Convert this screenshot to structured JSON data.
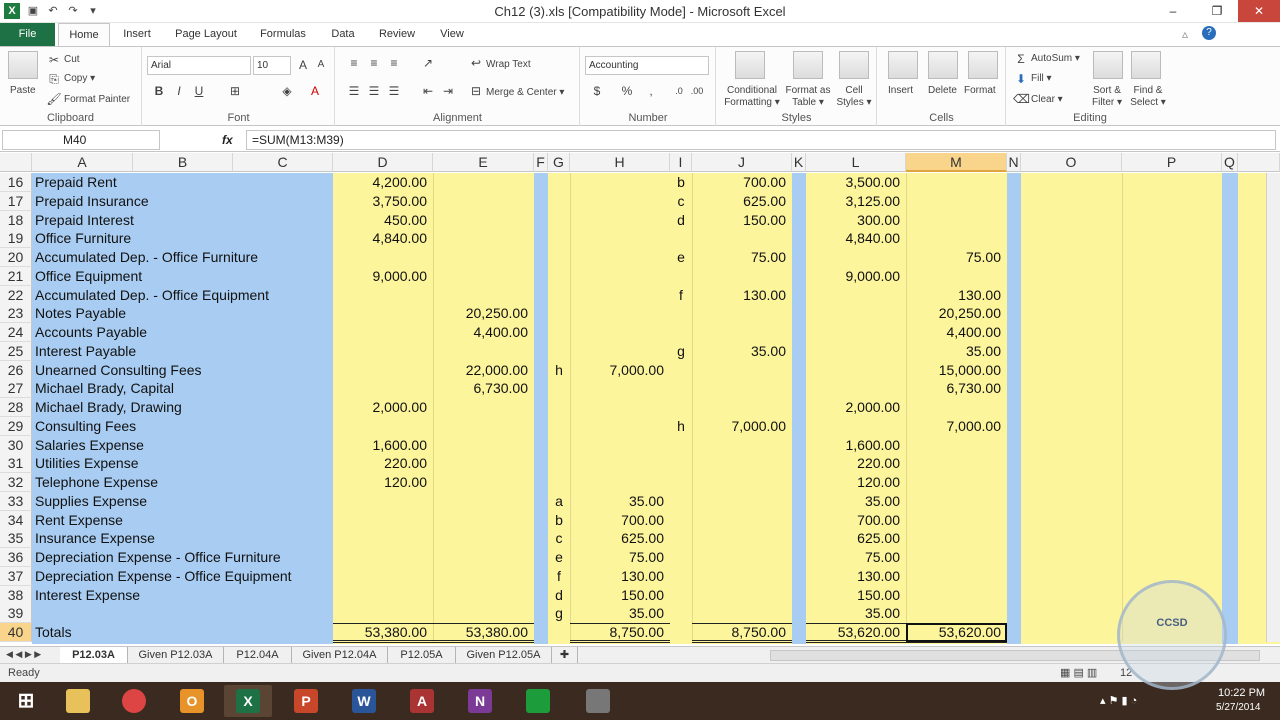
{
  "titlebar": {
    "title": "Ch12 (3).xls  [Compatibility Mode]  -  Microsoft Excel",
    "min": "–",
    "max": "❐",
    "close": "✕"
  },
  "tabs": {
    "file": "File",
    "items": [
      "Home",
      "Insert",
      "Page Layout",
      "Formulas",
      "Data",
      "Review",
      "View"
    ]
  },
  "ribbon": {
    "clipboard": {
      "label": "Clipboard",
      "paste": "Paste",
      "cut": "Cut",
      "copy": "Copy ▾",
      "format_painter": "Format Painter"
    },
    "font": {
      "label": "Font",
      "name": "Arial",
      "size": "10"
    },
    "alignment": {
      "label": "Alignment",
      "wrap": "Wrap Text",
      "merge": "Merge & Center ▾"
    },
    "number": {
      "label": "Number",
      "format": "Accounting"
    },
    "styles": {
      "label": "Styles",
      "conditional": "Conditional Formatting ▾",
      "format_table": "Format as Table ▾",
      "cell_styles": "Cell Styles ▾"
    },
    "cells": {
      "label": "Cells",
      "insert": "Insert",
      "delete": "Delete",
      "format": "Format"
    },
    "editing": {
      "label": "Editing",
      "autosum": "AutoSum ▾",
      "fill": "Fill ▾",
      "clear": "Clear ▾",
      "sort": "Sort & Filter ▾",
      "find": "Find & Select ▾"
    }
  },
  "formula_bar": {
    "name_box": "M40",
    "fx": "fx",
    "formula": "=SUM(M13:M39)"
  },
  "columns": [
    "A",
    "B",
    "C",
    "D",
    "E",
    "F",
    "G",
    "H",
    "I",
    "J",
    "K",
    "L",
    "M",
    "N",
    "O",
    "P",
    "Q"
  ],
  "rows": [
    {
      "n": "16",
      "a": "Prepaid Rent",
      "d": "4,200.00",
      "e": "",
      "g": "",
      "h": "",
      "i": "b",
      "j": "700.00",
      "l": "3,500.00",
      "m": ""
    },
    {
      "n": "17",
      "a": "Prepaid Insurance",
      "d": "3,750.00",
      "e": "",
      "g": "",
      "h": "",
      "i": "c",
      "j": "625.00",
      "l": "3,125.00",
      "m": ""
    },
    {
      "n": "18",
      "a": "Prepaid Interest",
      "d": "450.00",
      "e": "",
      "g": "",
      "h": "",
      "i": "d",
      "j": "150.00",
      "l": "300.00",
      "m": ""
    },
    {
      "n": "19",
      "a": "Office Furniture",
      "d": "4,840.00",
      "e": "",
      "g": "",
      "h": "",
      "i": "",
      "j": "",
      "l": "4,840.00",
      "m": ""
    },
    {
      "n": "20",
      "a": "Accumulated Dep. - Office Furniture",
      "d": "",
      "e": "",
      "g": "",
      "h": "",
      "i": "e",
      "j": "75.00",
      "l": "",
      "m": "75.00"
    },
    {
      "n": "21",
      "a": "Office Equipment",
      "d": "9,000.00",
      "e": "",
      "g": "",
      "h": "",
      "i": "",
      "j": "",
      "l": "9,000.00",
      "m": ""
    },
    {
      "n": "22",
      "a": "Accumulated Dep. - Office Equipment",
      "d": "",
      "e": "",
      "g": "",
      "h": "",
      "i": "f",
      "j": "130.00",
      "l": "",
      "m": "130.00"
    },
    {
      "n": "23",
      "a": "Notes Payable",
      "d": "",
      "e": "20,250.00",
      "g": "",
      "h": "",
      "i": "",
      "j": "",
      "l": "",
      "m": "20,250.00"
    },
    {
      "n": "24",
      "a": "Accounts Payable",
      "d": "",
      "e": "4,400.00",
      "g": "",
      "h": "",
      "i": "",
      "j": "",
      "l": "",
      "m": "4,400.00"
    },
    {
      "n": "25",
      "a": "Interest Payable",
      "d": "",
      "e": "",
      "g": "",
      "h": "",
      "i": "g",
      "j": "35.00",
      "l": "",
      "m": "35.00"
    },
    {
      "n": "26",
      "a": "Unearned Consulting Fees",
      "d": "",
      "e": "22,000.00",
      "g": "h",
      "h": "7,000.00",
      "i": "",
      "j": "",
      "l": "",
      "m": "15,000.00"
    },
    {
      "n": "27",
      "a": "Michael Brady, Capital",
      "d": "",
      "e": "6,730.00",
      "g": "",
      "h": "",
      "i": "",
      "j": "",
      "l": "",
      "m": "6,730.00"
    },
    {
      "n": "28",
      "a": "Michael Brady, Drawing",
      "d": "2,000.00",
      "e": "",
      "g": "",
      "h": "",
      "i": "",
      "j": "",
      "l": "2,000.00",
      "m": ""
    },
    {
      "n": "29",
      "a": "Consulting Fees",
      "d": "",
      "e": "",
      "g": "",
      "h": "",
      "i": "h",
      "j": "7,000.00",
      "l": "",
      "m": "7,000.00"
    },
    {
      "n": "30",
      "a": "Salaries Expense",
      "d": "1,600.00",
      "e": "",
      "g": "",
      "h": "",
      "i": "",
      "j": "",
      "l": "1,600.00",
      "m": ""
    },
    {
      "n": "31",
      "a": "Utilities Expense",
      "d": "220.00",
      "e": "",
      "g": "",
      "h": "",
      "i": "",
      "j": "",
      "l": "220.00",
      "m": ""
    },
    {
      "n": "32",
      "a": "Telephone Expense",
      "d": "120.00",
      "e": "",
      "g": "",
      "h": "",
      "i": "",
      "j": "",
      "l": "120.00",
      "m": ""
    },
    {
      "n": "33",
      "a": "Supplies Expense",
      "d": "",
      "e": "",
      "g": "a",
      "h": "35.00",
      "i": "",
      "j": "",
      "l": "35.00",
      "m": ""
    },
    {
      "n": "34",
      "a": "Rent Expense",
      "d": "",
      "e": "",
      "g": "b",
      "h": "700.00",
      "i": "",
      "j": "",
      "l": "700.00",
      "m": ""
    },
    {
      "n": "35",
      "a": "Insurance Expense",
      "d": "",
      "e": "",
      "g": "c",
      "h": "625.00",
      "i": "",
      "j": "",
      "l": "625.00",
      "m": ""
    },
    {
      "n": "36",
      "a": "Depreciation Expense - Office Furniture",
      "d": "",
      "e": "",
      "g": "e",
      "h": "75.00",
      "i": "",
      "j": "",
      "l": "75.00",
      "m": ""
    },
    {
      "n": "37",
      "a": "Depreciation Expense - Office Equipment",
      "d": "",
      "e": "",
      "g": "f",
      "h": "130.00",
      "i": "",
      "j": "",
      "l": "130.00",
      "m": ""
    },
    {
      "n": "38",
      "a": "Interest Expense",
      "d": "",
      "e": "",
      "g": "d",
      "h": "150.00",
      "i": "",
      "j": "",
      "l": "150.00",
      "m": ""
    },
    {
      "n": "39",
      "a": "",
      "d": "",
      "e": "",
      "g": "g",
      "h": "35.00",
      "i": "",
      "j": "",
      "l": "35.00",
      "m": ""
    },
    {
      "n": "40",
      "a": "Totals",
      "d": "53,380.00",
      "e": "53,380.00",
      "g": "",
      "h": "8,750.00",
      "i": "",
      "j": "8,750.00",
      "l": "53,620.00",
      "m": "53,620.00"
    }
  ],
  "sheets": [
    "P12.03A",
    "Given P12.03A",
    "P12.04A",
    "Given P12.04A",
    "P12.05A",
    "Given P12.05A"
  ],
  "status": {
    "ready": "Ready",
    "zoom": "12"
  },
  "clock": {
    "time": "10:22 PM",
    "date": "5/27/2014"
  },
  "watermark": {
    "text": "CCSD"
  },
  "colors": {
    "blue_fill": "#a9cdf2",
    "yellow_fill": "#fdf59c",
    "excel_green": "#1e7145"
  }
}
